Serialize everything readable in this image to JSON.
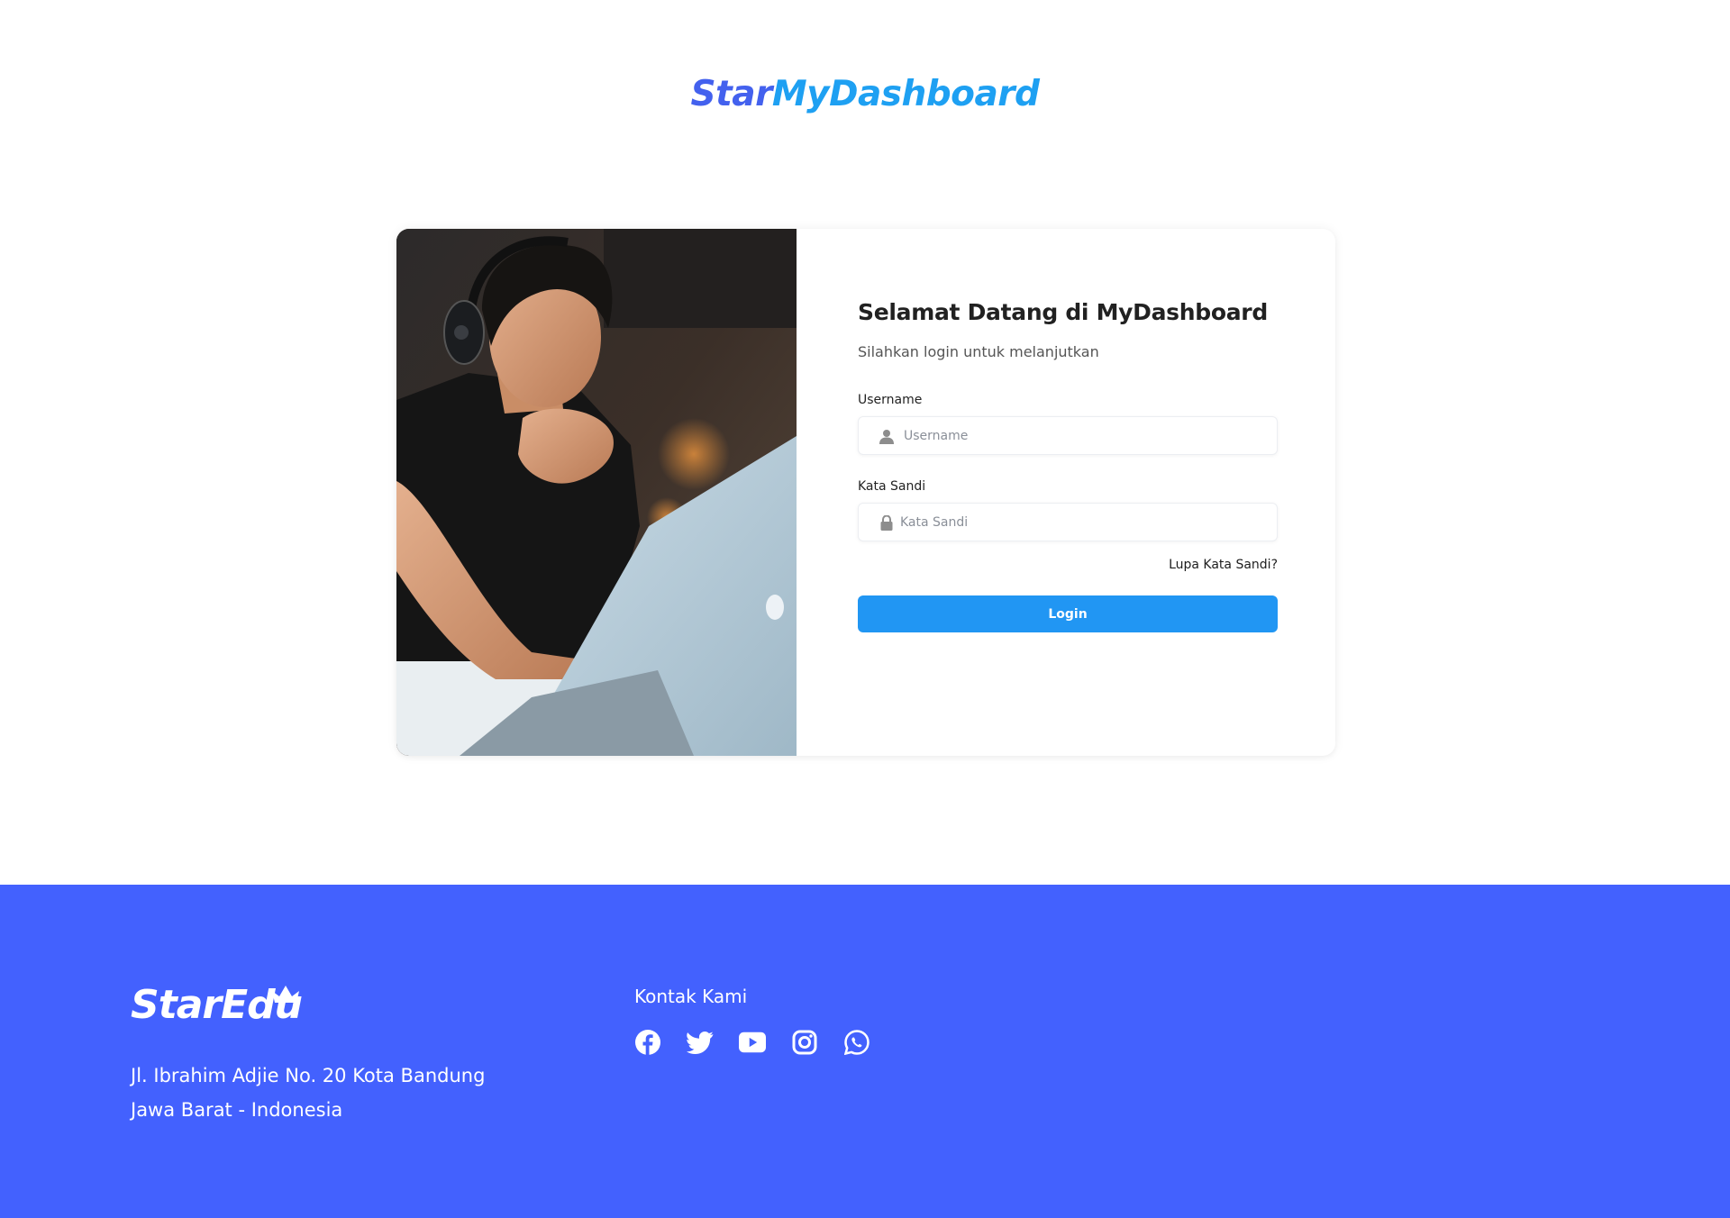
{
  "header": {
    "brand_part1": "Star",
    "brand_part2": "MyDashboard",
    "brand_colors": {
      "part1": "#4361ee",
      "part2": "#1ea0f2"
    }
  },
  "login": {
    "title": "Selamat Datang di MyDashboard",
    "subtitle": "Silahkan login untuk melanjutkan",
    "username": {
      "label": "Username",
      "placeholder": "Username",
      "value": "",
      "icon": "user-icon"
    },
    "password": {
      "label": "Kata Sandi",
      "placeholder": "Kata Sandi",
      "value": "",
      "icon": "lock-icon"
    },
    "forgot_link": "Lupa Kata Sandi?",
    "submit_label": "Login",
    "button_color": "#2196f3"
  },
  "footer": {
    "background": "#4361fe",
    "logo_text": "StarEdu",
    "address_line1": "Jl. Ibrahim Adjie No. 20 Kota Bandung",
    "address_line2": "Jawa Barat - Indonesia",
    "contact_title": "Kontak Kami",
    "socials": [
      "facebook-icon",
      "twitter-icon",
      "youtube-icon",
      "instagram-icon",
      "whatsapp-icon"
    ]
  }
}
